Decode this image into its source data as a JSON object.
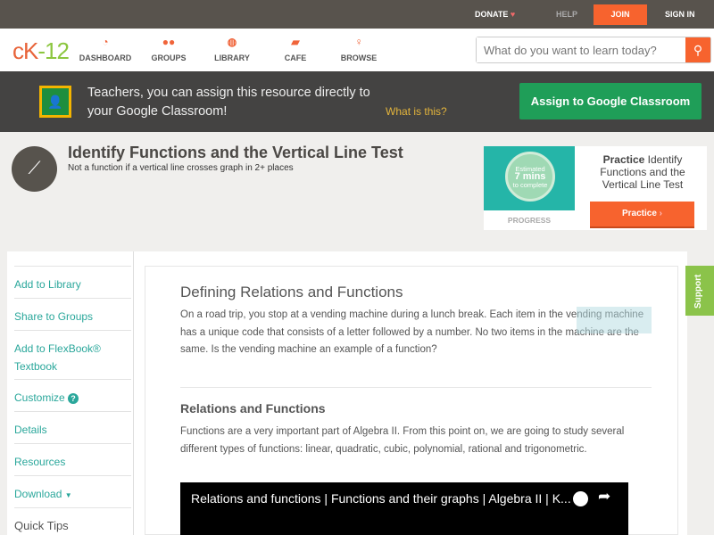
{
  "topbar": {
    "donate": "DONATE",
    "help": "HELP",
    "join": "JOIN",
    "signin": "SIGN IN"
  },
  "nav": {
    "logo_a": "cK",
    "logo_b": "-12",
    "items": [
      {
        "label": "DASHBOARD",
        "icon": "dashboard-icon"
      },
      {
        "label": "GROUPS",
        "icon": "groups-icon"
      },
      {
        "label": "LIBRARY",
        "icon": "library-icon"
      },
      {
        "label": "CAFE",
        "icon": "cafe-icon"
      },
      {
        "label": "BROWSE",
        "icon": "browse-icon"
      }
    ],
    "search_placeholder": "What do you want to learn today?"
  },
  "banner": {
    "text": "Teachers, you can assign this resource directly to your Google Classroom!",
    "link": "What is this?",
    "button": "Assign to Google Classroom"
  },
  "header": {
    "title": "Identify Functions and the Vertical Line Test",
    "subtitle": "Not a function if a vertical line crosses graph in 2+ places"
  },
  "practice": {
    "est1": "Estimated",
    "est2": "7 mins",
    "est3": "to complete",
    "progress": "PROGRESS",
    "label_bold": "Practice",
    "label_rest": "Identify Functions and the Vertical Line Test",
    "button": "Practice"
  },
  "sidebar": {
    "items": [
      "Add to Library",
      "Share to Groups",
      "Add to FlexBook® Textbook",
      "Customize",
      "Details",
      "Resources",
      "Download",
      "Quick Tips"
    ]
  },
  "content": {
    "h1": "Defining Relations and Functions",
    "p1": "On a road trip, you stop at a vending machine during a lunch break. Each item in the vending machine has a unique code that consists of a letter followed by a number. No two items in the machine are the same. Is the vending machine an example of a function?",
    "h2": "Relations and Functions",
    "p2": "Functions are a very important part of Algebra II. From this point on, we are going to study several different types of functions: linear, quadratic, cubic, polynomial, rational and trigonometric.",
    "video_title": "Relations and functions | Functions and their graphs | Algebra II | K..."
  },
  "support": "Support"
}
